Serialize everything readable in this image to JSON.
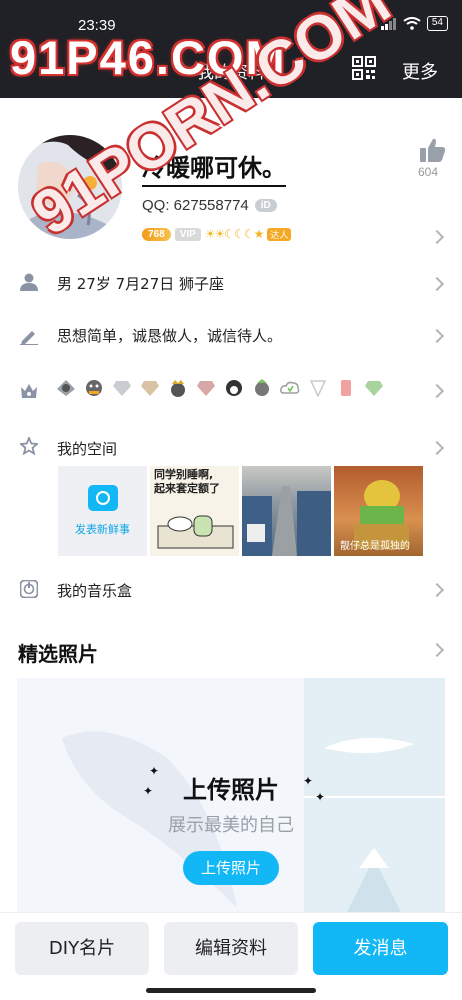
{
  "status_bar": {
    "time": "23:39",
    "network": "HD",
    "battery": "54"
  },
  "watermark": {
    "top": "91P46.COM",
    "diagonal": "91PORN.COM"
  },
  "nav": {
    "back_icon": "chevron-left-icon",
    "title": "我的资料",
    "qr_icon": "qr-code-icon",
    "more_label": "更多"
  },
  "profile": {
    "nickname": "冷暖哪可休。",
    "qq_label": "QQ: 627558774",
    "id_badge": "iD",
    "likes": "604",
    "vip_badge": "768",
    "svip_badge": "VIP",
    "level_icons": "☀☀☾☾☾★",
    "talent_badge": "达人"
  },
  "info": {
    "basic": "男  27岁   7月27日  狮子座",
    "signature": "思想简单，诚恳做人，诚信待人。",
    "my_space": "我的空间",
    "music_box": "我的音乐盒"
  },
  "space_tiles": {
    "post_label": "发表新鲜事",
    "meme_line1": "同学别睡啊,",
    "meme_line2": "起来套定额了",
    "chair_caption": "靓仔总是孤独的"
  },
  "photos": {
    "section_title": "精选照片",
    "upload_title": "上传照片",
    "upload_sub": "展示最美的自己",
    "upload_button": "上传照片"
  },
  "bottom": {
    "diy_label": "DIY名片",
    "edit_label": "编辑资料",
    "message_label": "发消息"
  },
  "colors": {
    "accent": "#12b7f5",
    "topbar": "#1f2126",
    "watermark_outline": "#d63131"
  }
}
